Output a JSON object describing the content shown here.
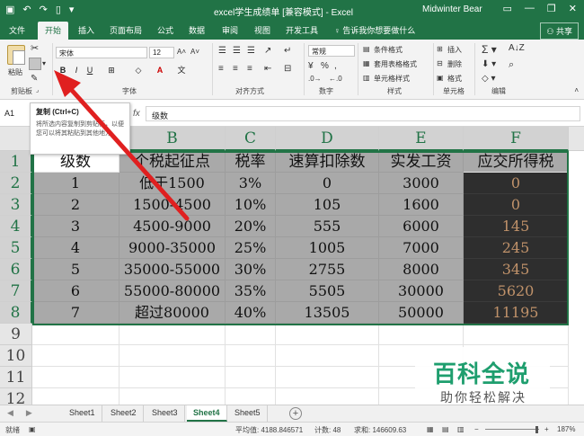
{
  "window": {
    "title": "excel学生成绩单 [兼容模式] - Excel",
    "user": "Midwinter Bear"
  },
  "ribbon_tabs": [
    "文件",
    "开始",
    "插入",
    "页面布局",
    "公式",
    "数据",
    "审阅",
    "视图",
    "开发工具"
  ],
  "active_tab": "开始",
  "tell_me": "告诉我你想要做什么",
  "share_label": "共享",
  "ribbon": {
    "paste_label": "粘贴",
    "font_name": "宋体",
    "font_size": "12",
    "number_format": "常规",
    "percent_symbol": "%",
    "comma_symbol": ",",
    "styles": [
      "条件格式",
      "套用表格格式",
      "单元格样式"
    ],
    "cells": [
      "插入",
      "删除",
      "格式"
    ],
    "group_labels": [
      "剪贴板",
      "字体",
      "对齐方式",
      "数字",
      "样式",
      "单元格",
      "编辑"
    ]
  },
  "formula_bar": {
    "name_box": "A1",
    "formula": "级数"
  },
  "tooltip": {
    "title": "复制 (Ctrl+C)",
    "description": "将所选内容复制到剪贴板，以便您可以将其粘贴到其他地方。"
  },
  "sheet": {
    "columns": [
      "A",
      "B",
      "C",
      "D",
      "E",
      "F"
    ],
    "rows": [
      "1",
      "2",
      "3",
      "4",
      "5",
      "6",
      "7",
      "8",
      "9",
      "10",
      "11",
      "12"
    ],
    "data": [
      [
        "级数",
        "个税起征点",
        "税率",
        "速算扣除数",
        "实发工资",
        "应交所得税"
      ],
      [
        "1",
        "低于1500",
        "3%",
        "0",
        "3000",
        "0"
      ],
      [
        "2",
        "1500-4500",
        "10%",
        "105",
        "1600",
        "0"
      ],
      [
        "3",
        "4500-9000",
        "20%",
        "555",
        "6000",
        "145"
      ],
      [
        "4",
        "9000-35000",
        "25%",
        "1005",
        "7000",
        "245"
      ],
      [
        "5",
        "35000-55000",
        "30%",
        "2755",
        "8000",
        "345"
      ],
      [
        "6",
        "55000-80000",
        "35%",
        "5505",
        "30000",
        "5620"
      ],
      [
        "7",
        "超过80000",
        "40%",
        "13505",
        "50000",
        "11195"
      ]
    ]
  },
  "sheet_tabs": [
    "Sheet1",
    "Sheet2",
    "Sheet3",
    "Sheet4",
    "Sheet5"
  ],
  "active_sheet": "Sheet4",
  "status": {
    "mode": "就绪",
    "average": "平均值: 4188.846571",
    "count": "计数: 48",
    "sum": "求和: 146609.63",
    "zoom": "187%"
  },
  "watermark": {
    "title": "百科全说",
    "subtitle": "助你轻松解决"
  },
  "colors": {
    "excel_green": "#217346",
    "selection_gray": "#a9a9a9",
    "dark_fill": "#2e2e2e",
    "result_text": "#c0926a",
    "arrow_red": "#e02020",
    "watermark_green": "#1e9e6e"
  }
}
